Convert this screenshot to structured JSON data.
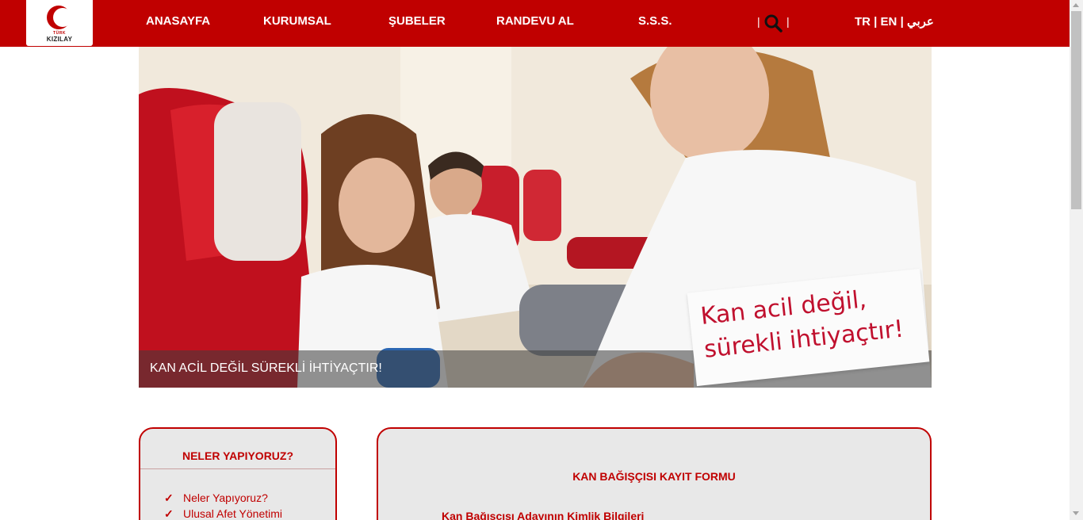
{
  "header": {
    "logo": {
      "small_text": "TÜRK",
      "name": "KIZILAY"
    },
    "nav": [
      {
        "label": "ANASAYFA"
      },
      {
        "label": "KURUMSAL"
      },
      {
        "label": "ŞUBELER"
      },
      {
        "label": "RANDEVU AL"
      },
      {
        "label": "S.S.S."
      }
    ],
    "search_icon": "search-icon",
    "separator": "|",
    "languages": {
      "tr": "TR",
      "en": "EN",
      "ar": "عربي"
    }
  },
  "hero": {
    "caption": "KAN ACİL DEĞİL SÜREKLİ İHTİYAÇTIR!",
    "sign_line1": "Kan acil değil,",
    "sign_line2": "sürekli ihtiyaçtır!"
  },
  "sidebar": {
    "title": "NELER YAPIYORUZ?",
    "check_mark": "✓",
    "items": [
      {
        "label": "Neler Yapıyoruz?"
      },
      {
        "label": "Ulusal Afet Yönetimi"
      }
    ]
  },
  "form": {
    "title": "KAN BAĞIŞÇISI KAYIT FORMU",
    "section_title": "Kan Bağışcısı Adayının Kimlik Bilgileri"
  },
  "colors": {
    "brand_red": "#c00000",
    "panel_bg": "#e8e8e8"
  }
}
